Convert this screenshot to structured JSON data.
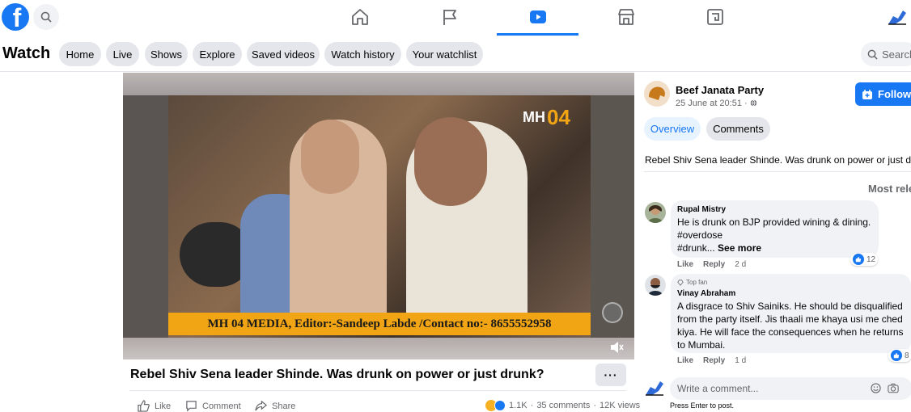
{
  "topbar": {
    "logo_letter": "f",
    "nav_icons": [
      "home-icon",
      "pages-flag-icon",
      "watch-icon",
      "marketplace-icon",
      "gaming-icon"
    ],
    "active": "watch-icon"
  },
  "watch": {
    "title": "Watch",
    "pills": [
      "Home",
      "Live",
      "Shows",
      "Explore",
      "Saved videos",
      "Watch history",
      "Your watchlist"
    ],
    "search_placeholder": "Search"
  },
  "video": {
    "overlay_logo": "MH",
    "overlay_logo_num": "04",
    "banner": "MH 04 MEDIA, Editor:-Sandeep Labde /Contact no:- 8655552958",
    "title": "Rebel Shiv Sena leader Shinde. Was drunk on power or just drunk?",
    "more_label": "···",
    "actions": {
      "like": "Like",
      "comment": "Comment",
      "share": "Share"
    },
    "reactions_count": "1.1K",
    "comments_count": "35 comments",
    "views_count": "12K views"
  },
  "post": {
    "page_name": "Beef Janata Party",
    "date": "25 June at 20:51 · ",
    "follow_label": "Follow",
    "tabs": [
      "Overview",
      "Comments"
    ],
    "caption": "Rebel Shiv Sena leader Shinde. Was drunk on power or just dru",
    "sort_label": "Most rele"
  },
  "comments": [
    {
      "name": "Rupal Mistry",
      "lines": [
        "He is drunk on BJP provided wining & dining.",
        "#overdose"
      ],
      "last_line": "#drunk... ",
      "see_more": "See more",
      "like": "Like",
      "reply": "Reply",
      "age": "2 d",
      "reactions": "12"
    },
    {
      "badge": "Top fan",
      "name": "Vinay Abraham",
      "lines": [
        "A disgrace to Shiv Sainiks. He should be disqualified",
        "from the party itself. Jis thaali me khaya usi me ched",
        "kiya. He will face the consequences when he returns",
        "to Mumbai."
      ],
      "like": "Like",
      "reply": "Reply",
      "age": "1 d",
      "reactions": "8"
    }
  ],
  "composer": {
    "placeholder": "Write a comment...",
    "hint": "Press Enter to post."
  },
  "colors": {
    "accent": "#1877f2",
    "banner": "#f1a414"
  }
}
